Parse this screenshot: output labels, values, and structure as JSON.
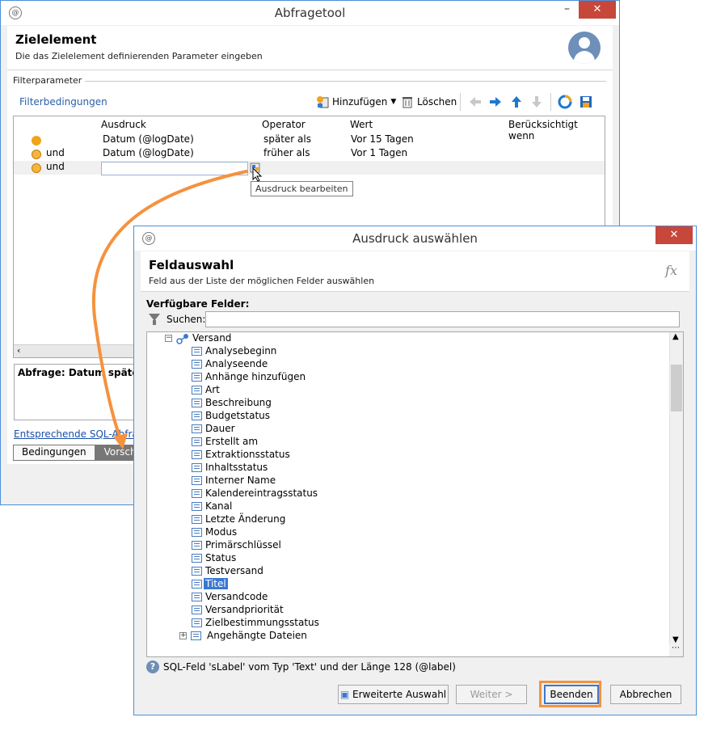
{
  "window1": {
    "title": "Abfragetool",
    "header_title": "Zielelement",
    "header_subtitle": "Die das Zielelement definierenden Parameter eingeben",
    "group_label": "Filterparameter",
    "filter_label": "Filterbedingungen",
    "toolbar": {
      "add": "Hinzufügen",
      "delete": "Löschen"
    },
    "columns": [
      "Ausdruck",
      "Operator",
      "Wert",
      "Berücksichtigt wenn"
    ],
    "rows": [
      {
        "connector": "",
        "expression": "Datum (@logDate)",
        "operator": "später als",
        "value": "Vor 15 Tagen"
      },
      {
        "connector": "und",
        "expression": "Datum (@logDate)",
        "operator": "früher als",
        "value": "Vor 1 Tagen"
      },
      {
        "connector": "und",
        "expression": "",
        "operator": "",
        "value": ""
      }
    ],
    "tooltip": "Ausdruck bearbeiten",
    "summary": "Abfrage: Datum später als",
    "sql_link": "Entsprechende SQL-Abfrage",
    "tabs": [
      "Bedingungen",
      "Vorscha"
    ]
  },
  "window2": {
    "title": "Ausdruck auswählen",
    "header_title": "Feldauswahl",
    "header_subtitle": "Feld aus der Liste der möglichen Felder auswählen",
    "fx": "fx",
    "available_label": "Verfügbare Felder:",
    "search_label": "Suchen:",
    "search_value": "",
    "tree_root": "Versand",
    "tree_items": [
      "Analysebeginn",
      "Analyseende",
      "Anhänge hinzufügen",
      "Art",
      "Beschreibung",
      "Budgetstatus",
      "Dauer",
      "Erstellt am",
      "Extraktionsstatus",
      "Inhaltsstatus",
      "Interner Name",
      "Kalendereintragsstatus",
      "Kanal",
      "Letzte Änderung",
      "Modus",
      "Primärschlüssel",
      "Status",
      "Testversand",
      "Titel",
      "Versandcode",
      "Versandpriorität",
      "Zielbestimmungsstatus"
    ],
    "selected_item": "Titel",
    "tree_last": "Angehängte Dateien",
    "info_text": "SQL-Feld 'sLabel' vom Typ 'Text' und der Länge 128 (@label)",
    "buttons": {
      "advanced": "Erweiterte Auswahl",
      "next": "Weiter >",
      "finish": "Beenden",
      "cancel": "Abbrechen"
    }
  },
  "colors": {
    "accent": "#f5923e",
    "selection": "#3b78d0",
    "close": "#c7473a",
    "link": "#2a5fa8"
  }
}
